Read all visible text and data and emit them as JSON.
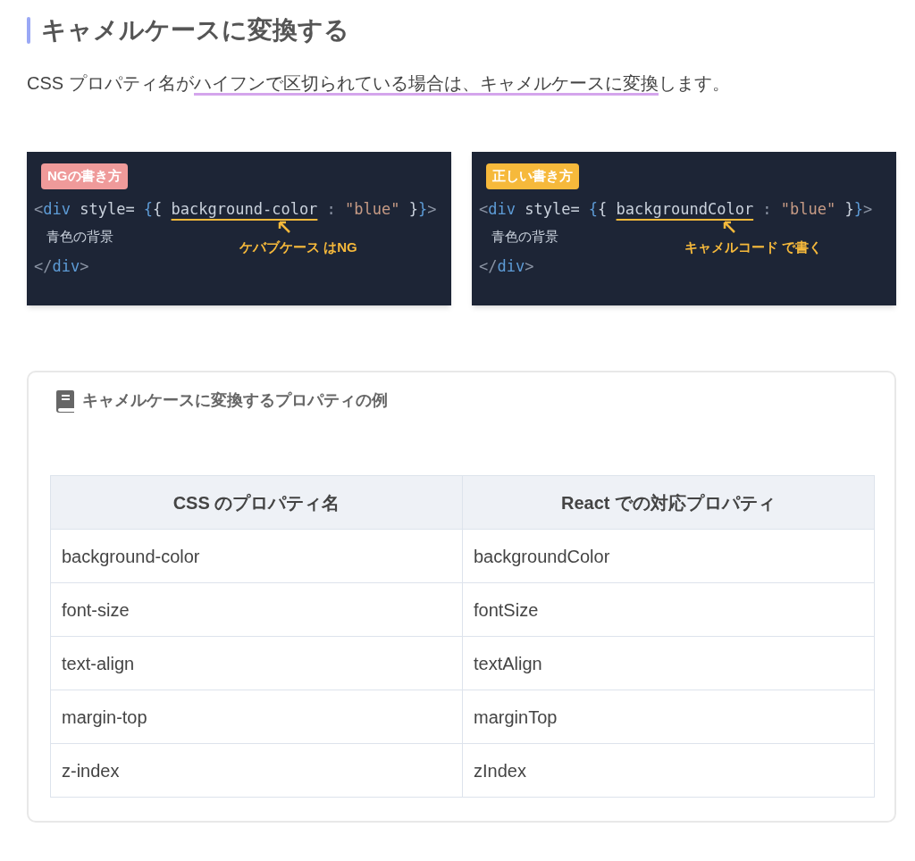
{
  "heading": "キャメルケースに変換する",
  "intro": {
    "before": "CSS プロパティ名が",
    "marked": "ハイフンで区切られている場合は、キャメルケースに変換",
    "after": "します。"
  },
  "examples": [
    {
      "badge": "NGの書き方",
      "color": "#ef9a9a",
      "tokens": [
        {
          "kind": "punct",
          "text": "<"
        },
        {
          "kind": "tag",
          "text": "div"
        },
        {
          "kind": "attr",
          "text": " style= "
        },
        {
          "kind": "brace",
          "text": "{"
        },
        {
          "kind": "attr",
          "text": "{ "
        },
        {
          "kind": "key",
          "text": "background-color"
        },
        {
          "kind": "punct",
          "text": " : "
        },
        {
          "kind": "string",
          "text": "\"blue\""
        },
        {
          "kind": "attr",
          "text": " }"
        },
        {
          "kind": "brace",
          "text": "}"
        },
        {
          "kind": "punct",
          "text": ">"
        }
      ],
      "body": "青色の背景",
      "close": [
        {
          "kind": "punct",
          "text": "</"
        },
        {
          "kind": "tag",
          "text": "div"
        },
        {
          "kind": "punct",
          "text": ">"
        }
      ],
      "note": "ケバブケース はNG"
    },
    {
      "badge": "正しい書き方",
      "color": "#f6b93b",
      "tokens": [
        {
          "kind": "punct",
          "text": "<"
        },
        {
          "kind": "tag",
          "text": "div"
        },
        {
          "kind": "attr",
          "text": " style= "
        },
        {
          "kind": "brace",
          "text": "{"
        },
        {
          "kind": "attr",
          "text": "{ "
        },
        {
          "kind": "key",
          "text": "backgroundColor"
        },
        {
          "kind": "punct",
          "text": " : "
        },
        {
          "kind": "string",
          "text": "\"blue\""
        },
        {
          "kind": "attr",
          "text": " }"
        },
        {
          "kind": "brace",
          "text": "}"
        },
        {
          "kind": "punct",
          "text": ">"
        }
      ],
      "body": "青色の背景",
      "close": [
        {
          "kind": "punct",
          "text": "</"
        },
        {
          "kind": "tag",
          "text": "div"
        },
        {
          "kind": "punct",
          "text": ">"
        }
      ],
      "note": "キャメルコード で書く"
    }
  ],
  "box": {
    "title": "キャメルケースに変換するプロパティの例",
    "table": {
      "columns": [
        "CSS のプロパティ名",
        "React での対応プロパティ"
      ],
      "rows": [
        [
          "background-color",
          "backgroundColor"
        ],
        [
          "font-size",
          "fontSize"
        ],
        [
          "text-align",
          "textAlign"
        ],
        [
          "margin-top",
          "marginTop"
        ],
        [
          "z-index",
          "zIndex"
        ]
      ]
    }
  }
}
